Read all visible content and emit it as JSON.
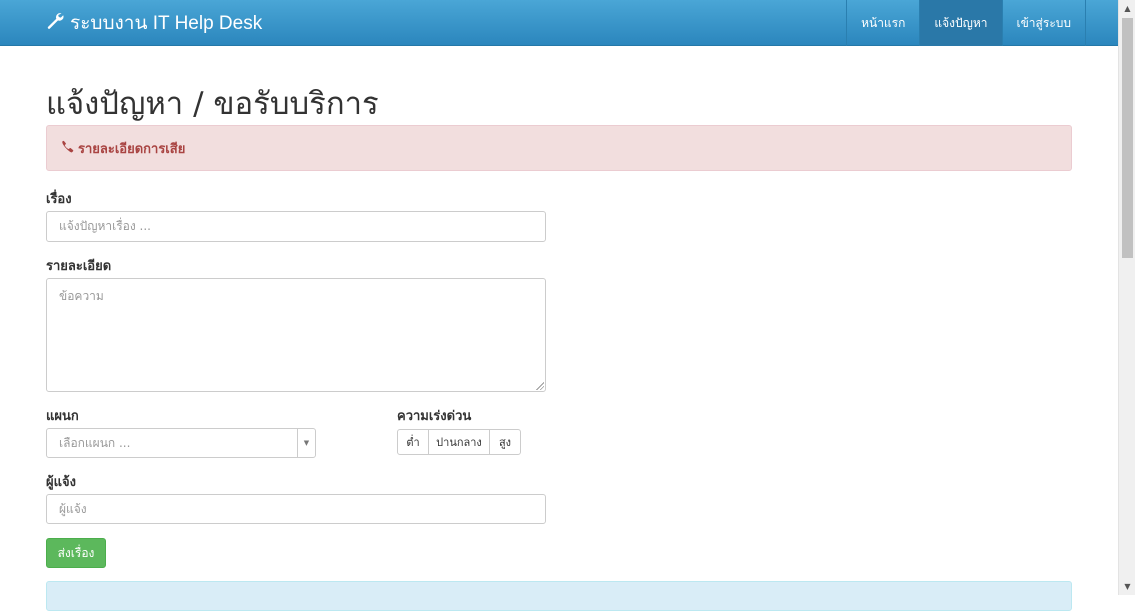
{
  "navbar": {
    "brand": "ระบบงาน IT Help Desk",
    "brand_icon": "wrench-icon",
    "items": [
      {
        "label": "หน้าแรก",
        "active": false
      },
      {
        "label": "แจ้งปัญหา",
        "active": true
      },
      {
        "label": "เข้าสู่ระบบ",
        "active": false
      }
    ],
    "colors": {
      "bar": "#3a97cb",
      "active": "#2a78a8"
    }
  },
  "page": {
    "title": "แจ้งปัญหา / ขอรับบริการ"
  },
  "alert": {
    "icon": "phone-icon",
    "text": "รายละเอียดการเสีย",
    "colors": {
      "background": "#f2dede",
      "text": "#a94442"
    }
  },
  "form": {
    "subject": {
      "label": "เรื่อง",
      "value": "",
      "placeholder": "แจ้งปัญหาเรื่อง ..."
    },
    "details": {
      "label": "รายละเอียด",
      "value": "",
      "placeholder": "ข้อความ"
    },
    "department": {
      "label": "แผนก",
      "selected": "เลือกแผนก ..."
    },
    "urgency": {
      "label": "ความเร่งด่วน",
      "options": [
        "ต่ำ",
        "ปานกลาง",
        "สูง"
      ]
    },
    "reporter": {
      "label": "ผู้แจ้ง",
      "value": "",
      "placeholder": "ผู้แจ้ง"
    },
    "submit_label": "ส่งเรื่อง",
    "submit_color": "#5cb85c"
  }
}
